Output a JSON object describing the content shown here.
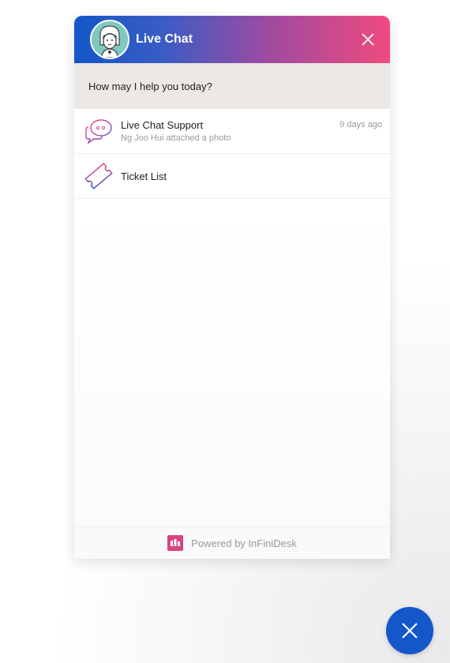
{
  "header": {
    "title": "Live Chat",
    "avatar_icon": "agent-avatar-icon",
    "close_icon": "close-icon"
  },
  "greeting": "How may I help you today?",
  "items": [
    {
      "title": "Live Chat Support",
      "subtitle": "Ng Joo Hui attached a photo",
      "time": "9 days ago",
      "icon": "chat-bubbles-icon"
    },
    {
      "title": "Ticket List",
      "icon": "ticket-icon"
    }
  ],
  "footer": {
    "text": "Powered by InFiniDesk",
    "logo_icon": "infinidesk-logo-icon"
  },
  "fab": {
    "icon": "close-icon"
  },
  "colors": {
    "header_gradient": [
      "#1357c8",
      "#a04aa0",
      "#f04a7e"
    ],
    "greeting_bg": "#ece8e3",
    "fab": "#1357c8",
    "brand": "#d8457f"
  }
}
